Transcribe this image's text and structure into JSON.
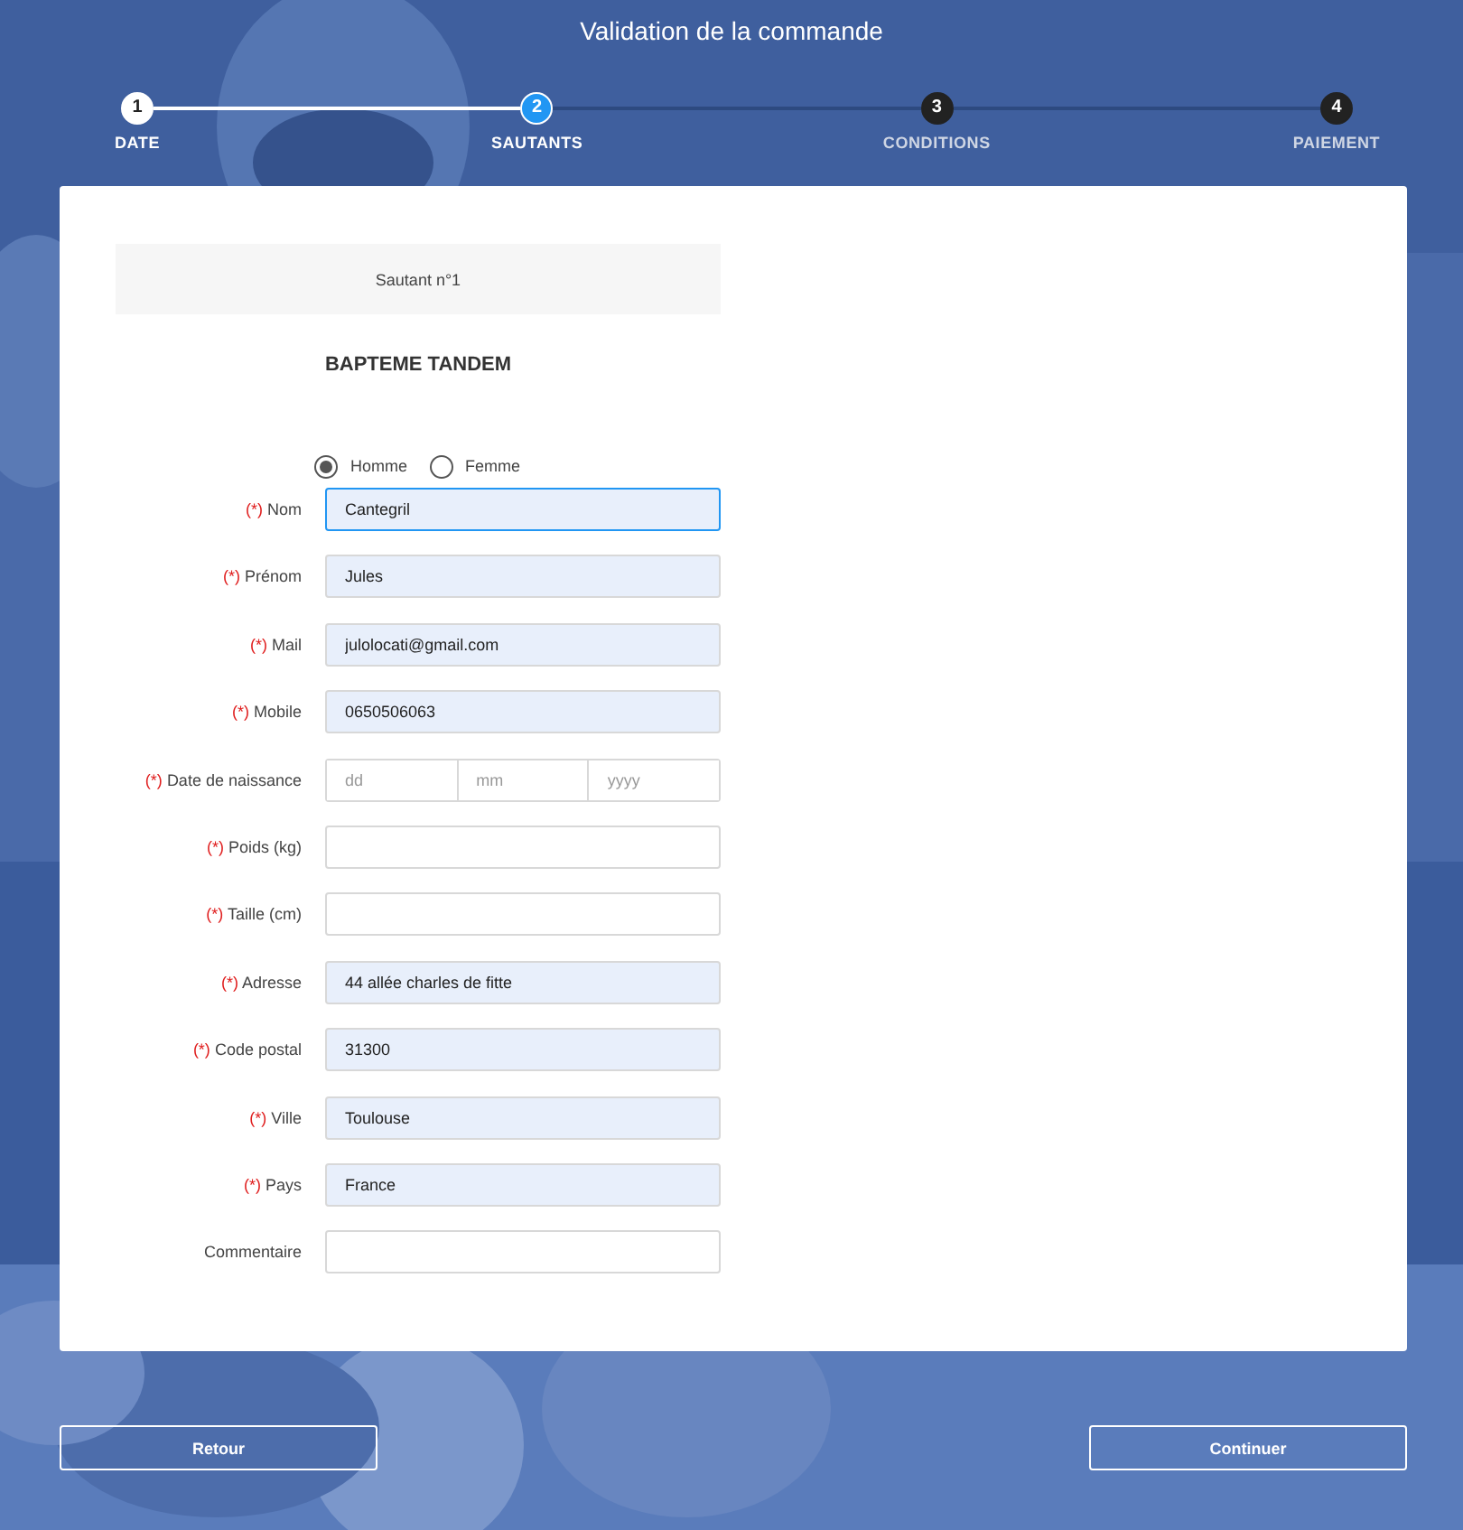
{
  "header": {
    "title": "Validation de la commande"
  },
  "steps": [
    {
      "number": "1",
      "label": "DATE",
      "completed": true,
      "selected": false
    },
    {
      "number": "2",
      "label": "SAUTANTS",
      "completed": false,
      "selected": true
    },
    {
      "number": "3",
      "label": "CONDITIONS",
      "completed": false,
      "selected": false
    },
    {
      "number": "4",
      "label": "PAIEMENT",
      "completed": false,
      "selected": false
    }
  ],
  "form": {
    "section": "Sautant n°1",
    "product": "BAPTEME TANDEM",
    "gender": [
      {
        "label": "Homme",
        "selected": true
      },
      {
        "label": "Femme",
        "selected": false
      }
    ],
    "fields": [
      {
        "kind": "text",
        "marker": "(*)",
        "label": "Nom",
        "value": "Cantegril",
        "focused": true
      },
      {
        "kind": "text",
        "marker": "(*)",
        "label": "Prénom",
        "value": "Jules",
        "focused": false
      },
      {
        "kind": "text",
        "marker": "(*)",
        "label": "Mail",
        "value": "julolocati@gmail.com",
        "focused": false
      },
      {
        "kind": "text",
        "marker": "(*)",
        "label": "Mobile",
        "value": "0650506063",
        "focused": false
      },
      {
        "kind": "date",
        "marker": "(*)",
        "label": "Date de naissance",
        "parts": [
          {
            "placeholder": "dd"
          },
          {
            "placeholder": "mm"
          },
          {
            "placeholder": "yyyy"
          }
        ]
      },
      {
        "kind": "text",
        "marker": "(*)",
        "label": "Poids (kg)",
        "focused": false
      },
      {
        "kind": "text",
        "marker": "(*)",
        "label": "Taille (cm)",
        "focused": false
      },
      {
        "kind": "text",
        "marker": "(*)",
        "label": "Adresse",
        "value": "44 allée charles de fitte",
        "focused": false
      },
      {
        "kind": "text",
        "marker": "(*)",
        "label": "Code postal",
        "value": "31300",
        "focused": false
      },
      {
        "kind": "text",
        "marker": "(*)",
        "label": "Ville",
        "value": "Toulouse",
        "focused": false
      },
      {
        "kind": "text",
        "marker": "(*)",
        "label": "Pays",
        "value": "France",
        "focused": false
      },
      {
        "kind": "text",
        "label": "Commentaire",
        "focused": false
      }
    ]
  },
  "buttons": [
    {
      "label": "Retour"
    },
    {
      "label": "Continuer"
    }
  ]
}
